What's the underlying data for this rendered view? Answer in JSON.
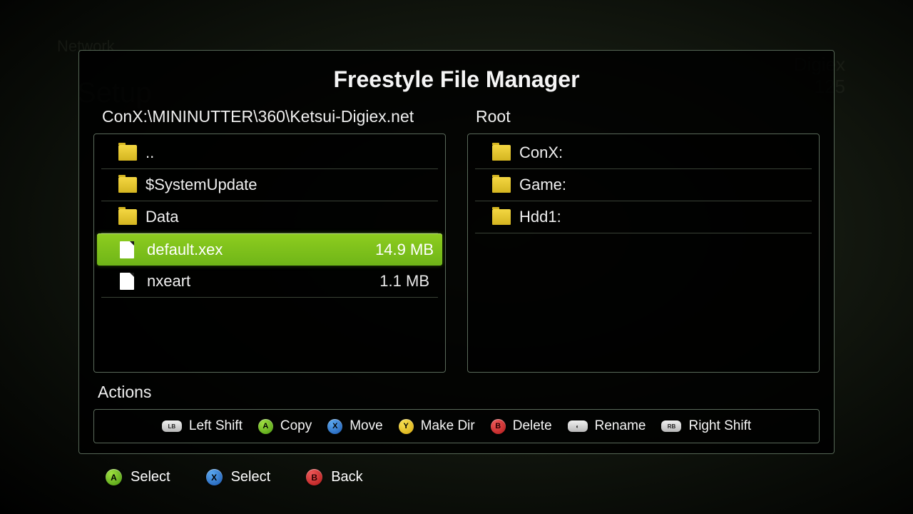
{
  "bg": {
    "network": "Network",
    "setup": "Setup",
    "tagLine1": "Digiex",
    "tagLine2": "125"
  },
  "title": "Freestyle File Manager",
  "leftPath": "ConX:\\MININUTTER\\360\\Ketsui-Digiex.net",
  "rightPath": "Root",
  "leftItems": [
    {
      "name": "..",
      "type": "folder",
      "size": ""
    },
    {
      "name": "$SystemUpdate",
      "type": "folder",
      "size": ""
    },
    {
      "name": "Data",
      "type": "folder",
      "size": ""
    },
    {
      "name": "default.xex",
      "type": "file",
      "size": "14.9 MB",
      "selected": true
    },
    {
      "name": "nxeart",
      "type": "file",
      "size": "1.1 MB"
    }
  ],
  "rightItems": [
    {
      "name": "ConX:",
      "type": "folder"
    },
    {
      "name": "Game:",
      "type": "folder"
    },
    {
      "name": "Hdd1:",
      "type": "folder"
    }
  ],
  "actionsLabel": "Actions",
  "actions": {
    "leftShift": "Left Shift",
    "copy": "Copy",
    "move": "Move",
    "makeDir": "Make Dir",
    "delete": "Delete",
    "rename": "Rename",
    "rightShift": "Right Shift"
  },
  "footer": {
    "selectA": "Select",
    "selectX": "Select",
    "back": "Back"
  },
  "glyphs": {
    "a": "A",
    "x": "X",
    "y": "Y",
    "b": "B",
    "lb": "LB",
    "rb": "RB",
    "bl": "◐",
    "br": "◑"
  }
}
